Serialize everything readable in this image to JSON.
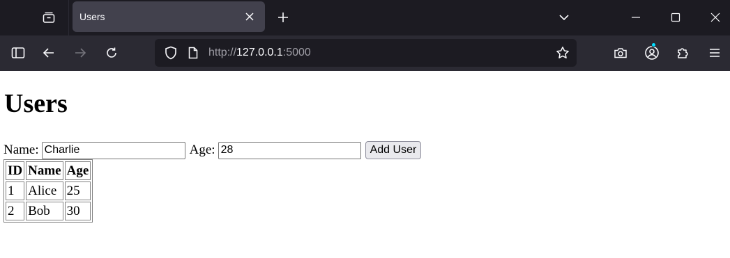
{
  "browser": {
    "tab": {
      "title": "Users"
    },
    "url": {
      "scheme": "http://",
      "host": "127.0.0.1",
      "port": ":5000"
    },
    "icons": {
      "tab_groups": "tab-groups-icon",
      "new_tab": "plus-icon",
      "tab_list": "chevron-down-icon",
      "minimize": "minimize-icon",
      "maximize": "maximize-icon",
      "close_window": "close-icon",
      "sidebar": "sidebar-icon",
      "back": "back-arrow-icon",
      "forward": "forward-arrow-icon",
      "reload": "reload-icon",
      "shield": "shield-icon",
      "page": "page-icon",
      "bookmark": "star-icon",
      "screenshot": "camera-icon",
      "account": "account-icon",
      "extensions": "puzzle-icon",
      "menu": "hamburger-menu-icon"
    },
    "colors": {
      "tabbar": "#1c1b22",
      "toolbar": "#2b2a33",
      "active_tab": "#42414d",
      "badge": "#00ddff"
    }
  },
  "page": {
    "heading": "Users",
    "form": {
      "name_label": "Name:",
      "name_value": "Charlie",
      "age_label": "Age:",
      "age_value": "28",
      "submit_label": "Add User"
    },
    "table": {
      "headers": [
        "ID",
        "Name",
        "Age"
      ],
      "rows": [
        [
          "1",
          "Alice",
          "25"
        ],
        [
          "2",
          "Bob",
          "30"
        ]
      ]
    }
  }
}
